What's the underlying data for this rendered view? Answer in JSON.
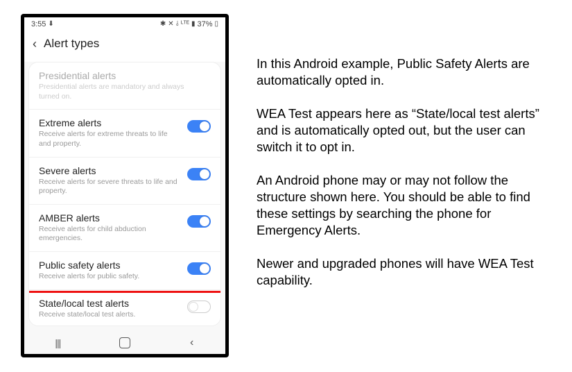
{
  "status_bar": {
    "time": "3:55",
    "download_icon": "⬇",
    "icons": {
      "bluetooth": "✱",
      "wifi_off": "✕",
      "signal": "▮",
      "lte": "ᴸᵀᴱ",
      "network": "⫰"
    },
    "battery_pct": "37%",
    "battery_icon": "▯"
  },
  "header": {
    "title": "Alert types"
  },
  "rows": {
    "presidential": {
      "title": "Presidential alerts",
      "desc": "Presidential alerts are mandatory and always turned on."
    },
    "extreme": {
      "title": "Extreme alerts",
      "desc": "Receive alerts for extreme threats to life and property."
    },
    "severe": {
      "title": "Severe alerts",
      "desc": "Receive alerts for severe threats to life and property."
    },
    "amber": {
      "title": "AMBER alerts",
      "desc": "Receive alerts for child abduction emergencies."
    },
    "public_safety": {
      "title": "Public safety alerts",
      "desc": "Receive alerts for public safety."
    },
    "state_local": {
      "title": "State/local test alerts",
      "desc": "Receive state/local test alerts."
    }
  },
  "explain": {
    "p1": "In this Android example, Public Safety Alerts are automatically opted in.",
    "p2": "WEA Test appears here as “State/local test alerts” and is automatically opted out, but the user can switch it to opt in.",
    "p3": "An Android phone may or may not follow the structure shown here. You should be able to find these settings by searching the phone for Emergency Alerts.",
    "p4": "Newer and upgraded phones will have WEA Test capability."
  }
}
